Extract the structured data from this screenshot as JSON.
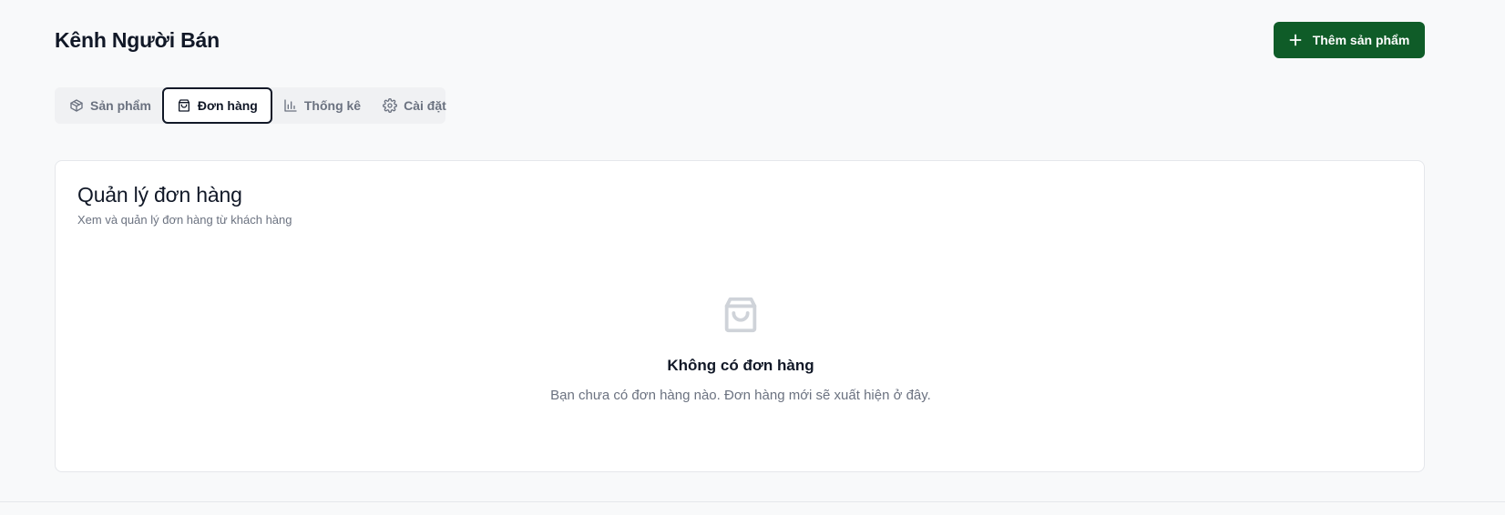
{
  "header": {
    "title": "Kênh Người Bán",
    "add_button_label": "Thêm sản phẩm",
    "add_button_icon": "plus-icon"
  },
  "tabs": [
    {
      "label": "Sản phẩm",
      "icon": "package-icon",
      "active": false
    },
    {
      "label": "Đơn hàng",
      "icon": "shopping-bag-icon",
      "active": true
    },
    {
      "label": "Thống kê",
      "icon": "bar-chart-icon",
      "active": false
    },
    {
      "label": "Cài đặt",
      "icon": "gear-icon",
      "active": false
    }
  ],
  "card": {
    "title": "Quản lý đơn hàng",
    "subtitle": "Xem và quản lý đơn hàng từ khách hàng",
    "empty_state": {
      "icon": "shopping-bag-icon",
      "title": "Không có đơn hàng",
      "description": "Bạn chưa có đơn hàng nào. Đơn hàng mới sẽ xuất hiện ở đây."
    }
  },
  "colors": {
    "background": "#f8f9fa",
    "accent": "#0f5c28",
    "muted_text": "#6b7280",
    "icon_muted": "#cfd3d9"
  }
}
